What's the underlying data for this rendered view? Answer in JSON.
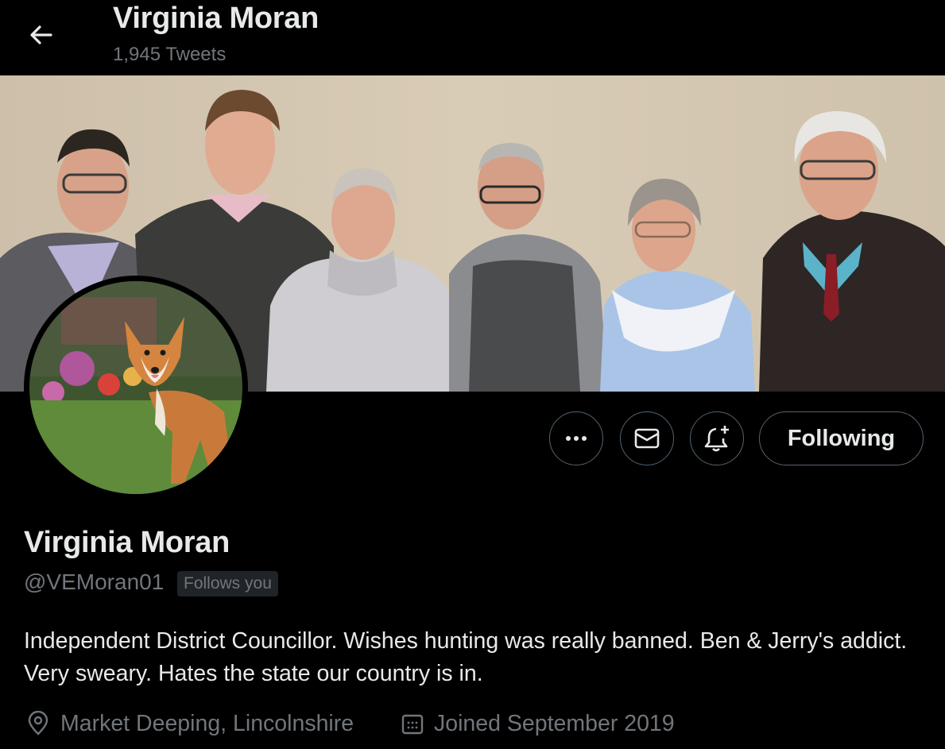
{
  "header": {
    "name": "Virginia Moran",
    "tweet_count": "1,945 Tweets",
    "back_icon": "arrow-left-icon"
  },
  "banner": {
    "description_icon": "group-photo"
  },
  "avatar": {
    "icon": "fox-photo"
  },
  "actions": {
    "more_icon": "more-horizontal-icon",
    "message_icon": "envelope-icon",
    "notify_icon": "bell-plus-icon",
    "following_label": "Following"
  },
  "profile": {
    "name": "Virginia Moran",
    "handle": "@VEMoran01",
    "follows_badge": "Follows you",
    "bio": "Independent District Councillor. Wishes hunting was really banned. Ben & Jerry's addict. Very sweary. Hates the state our country is in.",
    "location": "Market Deeping, Lincolnshire",
    "joined": "Joined September 2019"
  },
  "colors": {
    "background": "#000000",
    "text_primary": "#e7e9ea",
    "text_secondary": "#71767b",
    "border": "#536471",
    "badge_bg": "#202327"
  }
}
